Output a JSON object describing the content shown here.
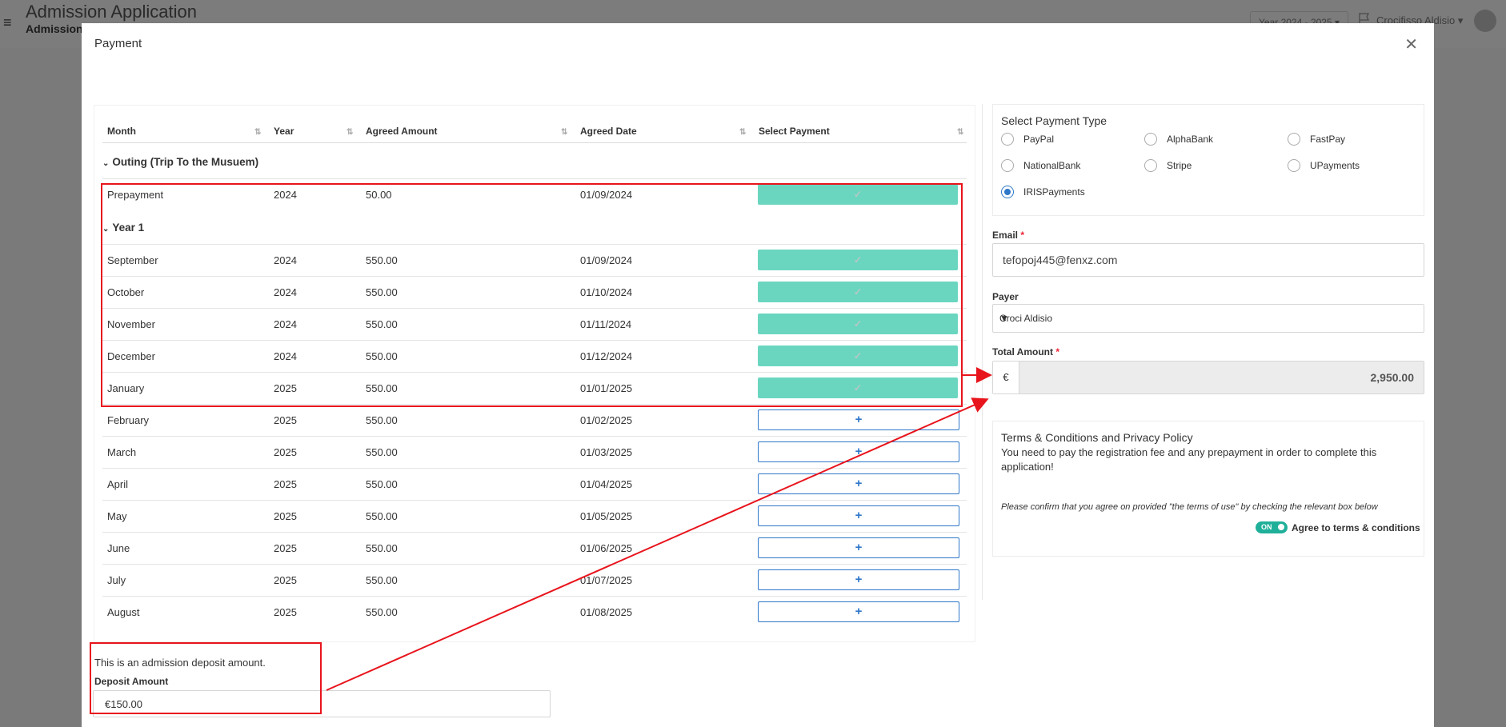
{
  "header": {
    "app_title": "Admission Application",
    "subtitle": "Admission",
    "year_selector": "Year 2024 - 2025",
    "user_name": "Crocifisso Aldisio"
  },
  "modal": {
    "title": "Payment"
  },
  "table": {
    "columns": [
      "Month",
      "Year",
      "Agreed Amount",
      "Agreed Date",
      "Select Payment"
    ],
    "groups": [
      {
        "label": "Outing (Trip To the Musuem)",
        "rows": [
          {
            "month": "Prepayment",
            "year": "2024",
            "amount": "50.00",
            "date": "01/09/2024",
            "status": "paid"
          }
        ]
      },
      {
        "label": "Year 1",
        "rows": [
          {
            "month": "September",
            "year": "2024",
            "amount": "550.00",
            "date": "01/09/2024",
            "status": "paid"
          },
          {
            "month": "October",
            "year": "2024",
            "amount": "550.00",
            "date": "01/10/2024",
            "status": "paid"
          },
          {
            "month": "November",
            "year": "2024",
            "amount": "550.00",
            "date": "01/11/2024",
            "status": "paid"
          },
          {
            "month": "December",
            "year": "2024",
            "amount": "550.00",
            "date": "01/12/2024",
            "status": "paid"
          },
          {
            "month": "January",
            "year": "2025",
            "amount": "550.00",
            "date": "01/01/2025",
            "status": "paid"
          },
          {
            "month": "February",
            "year": "2025",
            "amount": "550.00",
            "date": "01/02/2025",
            "status": "add"
          },
          {
            "month": "March",
            "year": "2025",
            "amount": "550.00",
            "date": "01/03/2025",
            "status": "add"
          },
          {
            "month": "April",
            "year": "2025",
            "amount": "550.00",
            "date": "01/04/2025",
            "status": "add"
          },
          {
            "month": "May",
            "year": "2025",
            "amount": "550.00",
            "date": "01/05/2025",
            "status": "add"
          },
          {
            "month": "June",
            "year": "2025",
            "amount": "550.00",
            "date": "01/06/2025",
            "status": "add"
          },
          {
            "month": "July",
            "year": "2025",
            "amount": "550.00",
            "date": "01/07/2025",
            "status": "add"
          },
          {
            "month": "August",
            "year": "2025",
            "amount": "550.00",
            "date": "01/08/2025",
            "status": "add"
          }
        ]
      }
    ],
    "paid_glyph": "✓",
    "add_glyph": "+"
  },
  "deposit": {
    "note": "This is an admission deposit amount.",
    "label": "Deposit Amount",
    "value": "€150.00"
  },
  "payment_type": {
    "title": "Select Payment Type",
    "options": [
      "PayPal",
      "AlphaBank",
      "FastPay",
      "NationalBank",
      "Stripe",
      "UPayments",
      "IRISPayments"
    ],
    "selected": "IRISPayments"
  },
  "email": {
    "label": "Email",
    "value": "tefopoj445@fenxz.com"
  },
  "payer": {
    "label": "Payer",
    "value": "Croci Aldisio"
  },
  "total": {
    "label": "Total Amount",
    "currency": "€",
    "value": "2,950.00"
  },
  "terms": {
    "title": "Terms & Conditions and Privacy Policy",
    "text": "You need to pay the registration fee and any prepayment in order to complete this application!",
    "confirm": "Please confirm that you agree on provided \"the terms of use\" by checking the relevant box below",
    "toggle_label": "ON",
    "agree_label": "Agree to terms & conditions"
  },
  "colors": {
    "paid": "#6bd6c0",
    "add_border": "#2e77c9",
    "annotation": "#e8141c",
    "toggle": "#20b09a"
  }
}
